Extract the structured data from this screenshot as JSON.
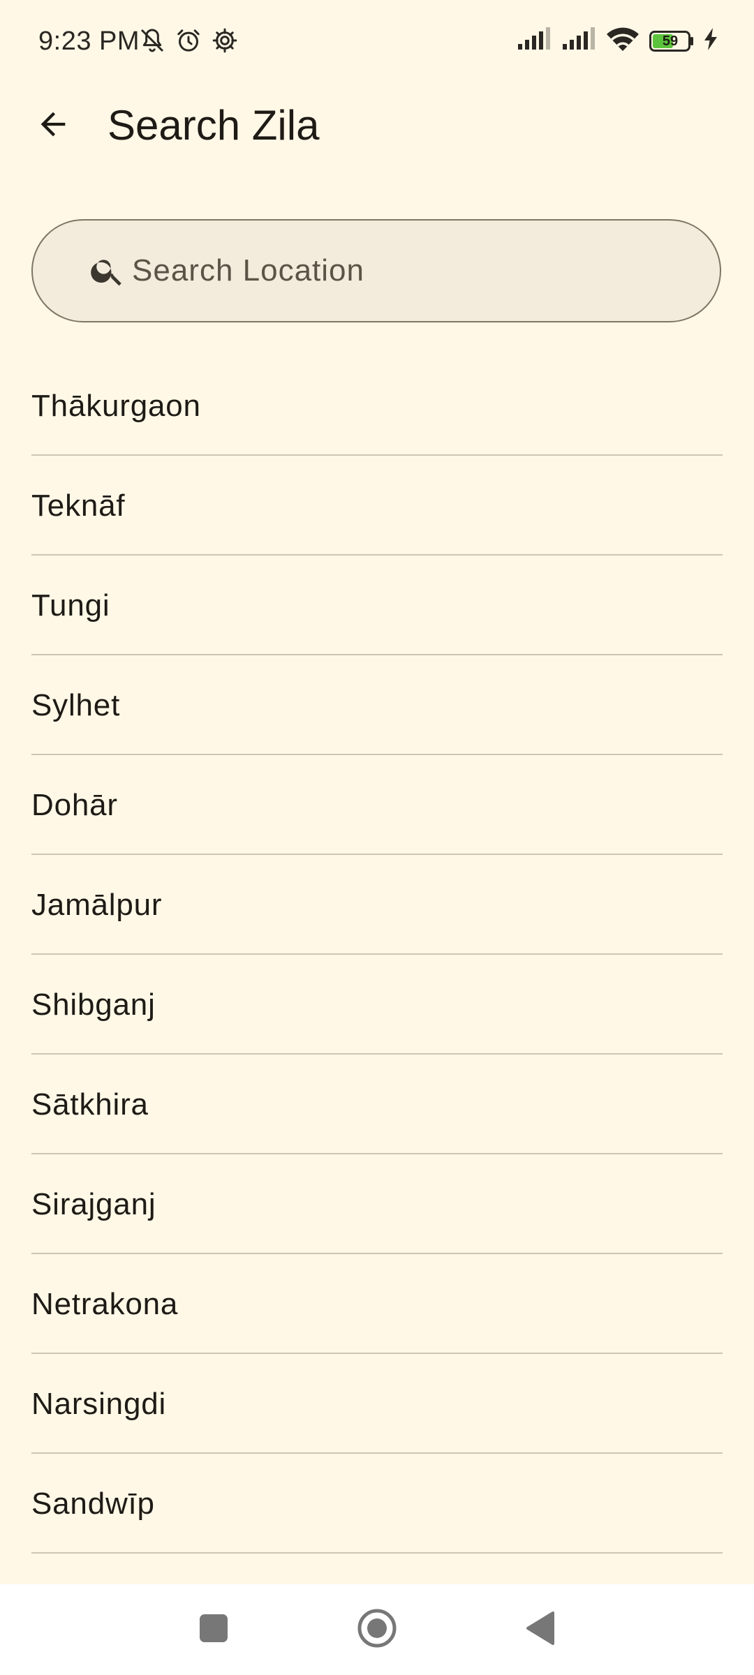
{
  "status_bar": {
    "time": "9:23 PM",
    "battery_level": "59",
    "left_icons": [
      "bell-off-icon",
      "alarm-icon",
      "settings-icon"
    ],
    "right_icons": [
      "signal-icon",
      "signal-icon",
      "wifi-icon",
      "battery-icon",
      "charging-icon"
    ]
  },
  "app_bar": {
    "title": "Search Zila",
    "back_icon": "arrow-back-icon"
  },
  "search": {
    "placeholder": "Search Location",
    "value": "",
    "icon": "search-icon"
  },
  "locations": [
    "Thākurgaon",
    "Teknāf",
    "Tungi",
    "Sylhet",
    "Dohār",
    "Jamālpur",
    "Shibganj",
    "Sātkhira",
    "Sirajganj",
    "Netrakona",
    "Narsingdi",
    "Sandwīp"
  ],
  "nav_bar": {
    "buttons": [
      "recents-icon",
      "home-icon",
      "back-icon"
    ]
  },
  "colors": {
    "background": "#FFF8E7",
    "search_fill": "#F3ECDC",
    "search_border": "#7D7665",
    "divider": "#CDC6B4",
    "text": "#1E1B16",
    "battery_fill": "#5CC43C",
    "nav_bar_background": "#FFFFFF"
  }
}
